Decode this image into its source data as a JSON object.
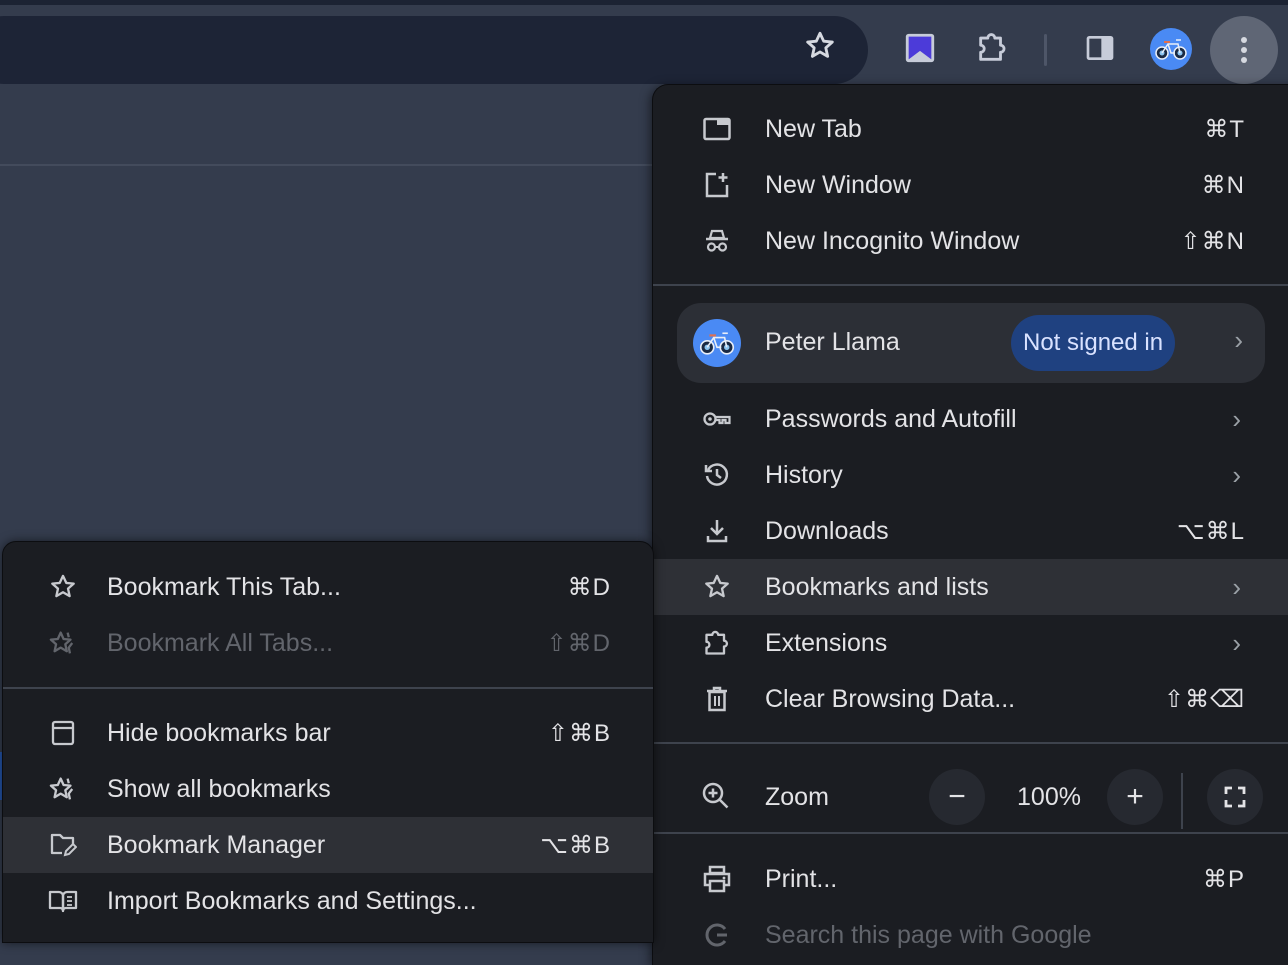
{
  "toolbar": {
    "bookmark_star_icon": "star-outline-icon",
    "extensions": [
      {
        "name": "bookmark-extension-icon",
        "color": "#4c3bd9"
      },
      {
        "name": "puzzle-extensions-icon"
      }
    ],
    "side_panel_icon": "side-panel-icon",
    "profile_icon": "bicycle-avatar-icon",
    "menu_icon": "three-dots-vertical-icon",
    "accent_color": "#4a8af4"
  },
  "main_menu": {
    "items_top": [
      {
        "icon": "new-tab-icon",
        "label": "New Tab",
        "shortcut": "⌘T"
      },
      {
        "icon": "new-window-icon",
        "label": "New Window",
        "shortcut": "⌘N"
      },
      {
        "icon": "incognito-icon",
        "label": "New Incognito Window",
        "shortcut": "⇧⌘N"
      }
    ],
    "profile": {
      "name": "Peter Llama",
      "status": "Not signed in",
      "chevron": "›"
    },
    "items_mid": [
      {
        "icon": "key-icon",
        "label": "Passwords and Autofill",
        "chevron": "›"
      },
      {
        "icon": "history-icon",
        "label": "History",
        "chevron": "›"
      },
      {
        "icon": "download-icon",
        "label": "Downloads",
        "shortcut": "⌥⌘L"
      },
      {
        "icon": "star-icon",
        "label": "Bookmarks and lists",
        "chevron": "›",
        "highlighted": true
      },
      {
        "icon": "puzzle-icon",
        "label": "Extensions",
        "chevron": "›"
      },
      {
        "icon": "trash-icon",
        "label": "Clear Browsing Data...",
        "shortcut": "⇧⌘⌫"
      }
    ],
    "zoom": {
      "label": "Zoom",
      "minus": "−",
      "value": "100%",
      "plus": "+"
    },
    "items_bottom": [
      {
        "icon": "print-icon",
        "label": "Print...",
        "shortcut": "⌘P"
      },
      {
        "icon": "google-icon",
        "label": "Search this page with Google",
        "disabled": true
      }
    ]
  },
  "bookmarks_submenu": {
    "items": [
      {
        "icon": "star-icon",
        "label": "Bookmark This Tab...",
        "shortcut": "⌘D"
      },
      {
        "icon": "stars-icon",
        "label": "Bookmark All Tabs...",
        "shortcut": "⇧⌘D",
        "disabled": true
      },
      {
        "icon": "bookmarks-bar-icon",
        "label": "Hide bookmarks bar",
        "shortcut": "⇧⌘B"
      },
      {
        "icon": "stars-icon",
        "label": "Show all bookmarks"
      },
      {
        "icon": "folder-edit-icon",
        "label": "Bookmark Manager",
        "shortcut": "⌥⌘B",
        "highlighted": true
      },
      {
        "icon": "book-open-icon",
        "label": "Import Bookmarks and Settings..."
      }
    ]
  }
}
